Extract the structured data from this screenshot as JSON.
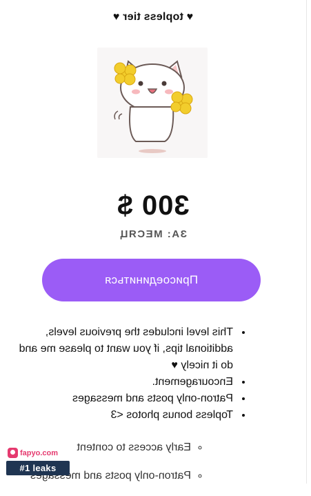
{
  "tier": {
    "title": "♥ topless tier ♥",
    "image_alt": "cat with pom-poms",
    "price": "300 $",
    "period": "ЗА: МЕСЯЦ",
    "join_label": "Присоединиться"
  },
  "benefits": [
    "This level includes the previous levels, additional tips, if you want to please me and do it nicely ♥",
    "Encouragement.",
    "Patron-only posts and messages",
    "Topless bonus photos <3"
  ],
  "sub_benefits": [
    "Early access to content",
    "Patron-only posts and messages"
  ],
  "watermark": {
    "site": "fapyo.com",
    "tagline": "#1 leaks"
  },
  "colors": {
    "accent": "#9b5cf6",
    "watermark_pink": "#e53a6f",
    "watermark_navy": "#1f3552"
  }
}
